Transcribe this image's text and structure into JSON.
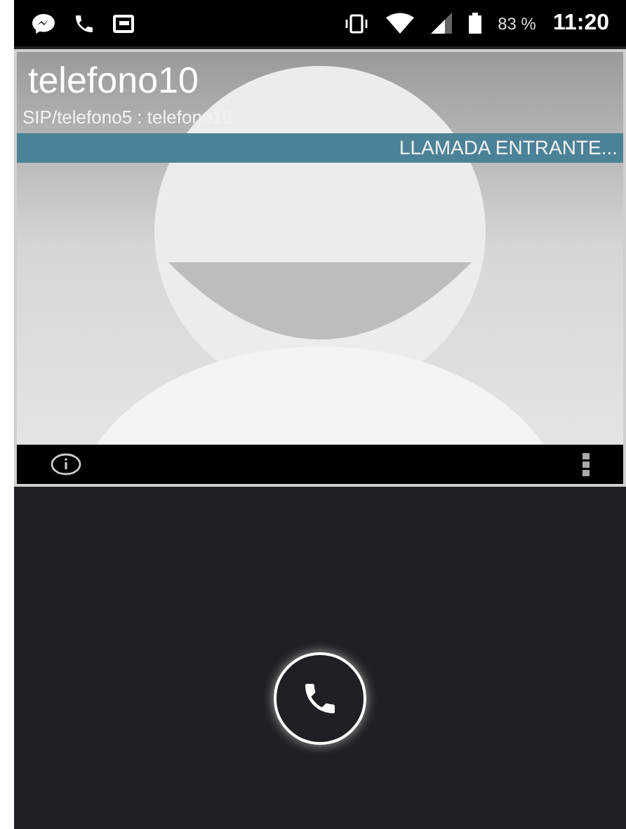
{
  "status_bar": {
    "battery": "83 %",
    "time": "11:20"
  },
  "caller": {
    "name": "telefono10",
    "address": "SIP/telefono5 : telefono10"
  },
  "call_state": "LLAMADA ENTRANTE..."
}
